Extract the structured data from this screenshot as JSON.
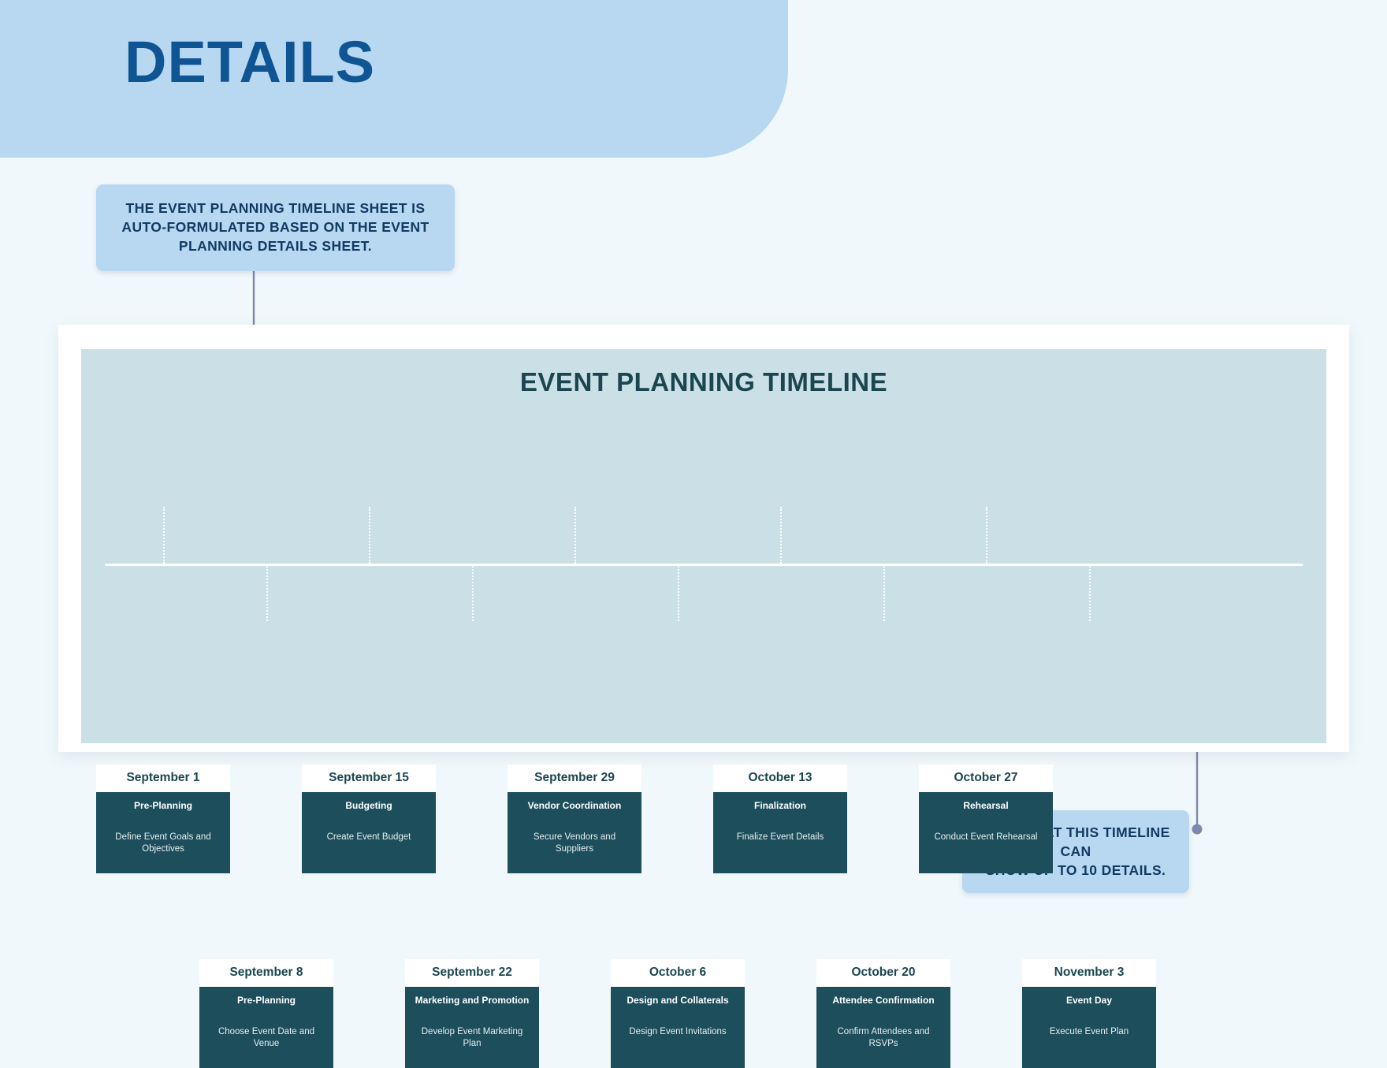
{
  "header": {
    "title": "DETAILS",
    "banner_color": "#b7d8f0",
    "title_color": "#105593"
  },
  "callouts": [
    {
      "name": "top-callout",
      "line1": "THE EVENT PLANNING TIMELINE SHEET IS",
      "line2": "AUTO-FORMULATED BASED ON THE EVENT",
      "line3": "PLANNING DETAILS SHEET."
    },
    {
      "name": "bottom-callout",
      "line1": "NOTE THAT THIS TIMELINE CAN",
      "line2": "SHOW UP TO 10 DETAILS."
    }
  ],
  "timeline": {
    "title": "EVENT PLANNING TIMELINE",
    "accent_dark": "#1d4e5b",
    "panel_bg": "#cbdfe6",
    "connector_color": "#7c88ad",
    "top_row": [
      {
        "date": "September 1",
        "phase": "Pre-Planning",
        "task": "Define Event Goals and Objectives"
      },
      {
        "date": "September 15",
        "phase": "Budgeting",
        "task": "Create Event Budget"
      },
      {
        "date": "September 29",
        "phase": "Vendor Coordination",
        "task": "Secure Vendors and Suppliers"
      },
      {
        "date": "October 13",
        "phase": "Finalization",
        "task": "Finalize Event Details"
      },
      {
        "date": "October 27",
        "phase": "Rehearsal",
        "task": "Conduct Event Rehearsal"
      }
    ],
    "bottom_row": [
      {
        "date": "September 8",
        "phase": "Pre-Planning",
        "task": "Choose Event Date and Venue"
      },
      {
        "date": "September 22",
        "phase": "Marketing and Promotion",
        "task": "Develop Event Marketing Plan"
      },
      {
        "date": "October 6",
        "phase": "Design and Collaterals",
        "task": "Design Event Invitations"
      },
      {
        "date": "October 20",
        "phase": "Attendee Confirmation",
        "task": "Confirm Attendees and RSVPs"
      },
      {
        "date": "November 3",
        "phase": "Event Day",
        "task": "Execute Event Plan"
      }
    ]
  }
}
